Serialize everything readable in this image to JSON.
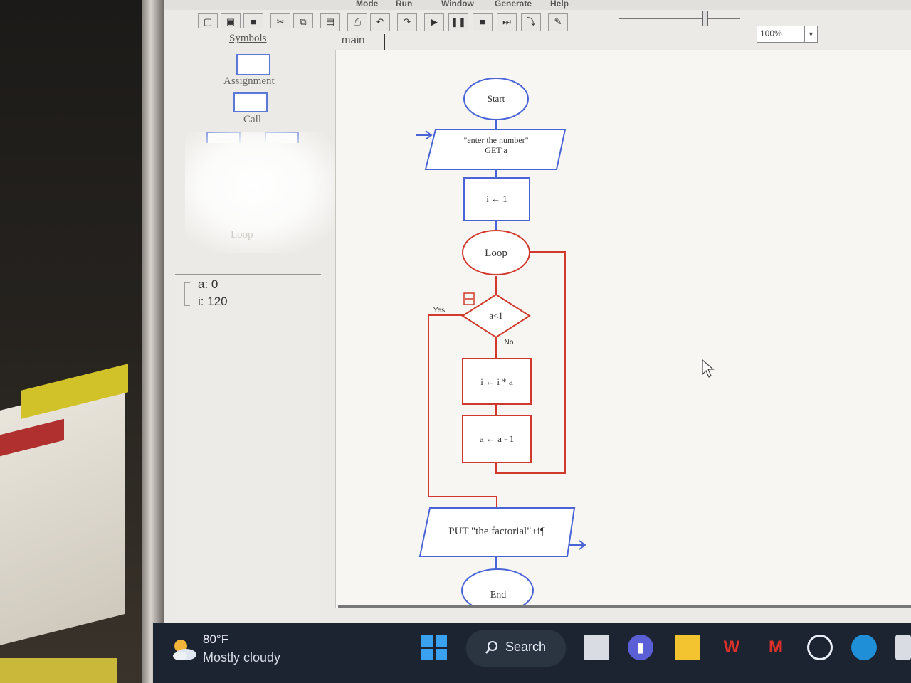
{
  "menubar": {
    "items": [
      "Mode",
      "Run",
      "Window",
      "Generate",
      "Help"
    ]
  },
  "toolbar": {
    "zoom_value": "100%"
  },
  "symbols_panel": {
    "title": "Symbols",
    "items": [
      "Assignment",
      "Call",
      "Loop"
    ]
  },
  "variables": [
    {
      "name": "a",
      "value": "0"
    },
    {
      "name": "i",
      "value": "120"
    }
  ],
  "workspace": {
    "tab": "main"
  },
  "flowchart": {
    "start": "Start",
    "input_prompt": "\"enter the number\"",
    "input_get": "GET a",
    "assign_init": "i ← 1",
    "loop": "Loop",
    "condition": "a<1",
    "yes_label": "Yes",
    "no_label": "No",
    "assign_mult": "i ← i * a",
    "assign_dec": "a ← a - 1",
    "output": "PUT \"the factorial\"+i¶",
    "end": "End"
  },
  "taskbar": {
    "weather_temp": "80°F",
    "weather_desc": "Mostly cloudy",
    "search_label": "Search"
  },
  "colors": {
    "flow_blue": "#4a64d8",
    "flow_red": "#d0392b",
    "taskbar_bg": "#1b2430"
  }
}
